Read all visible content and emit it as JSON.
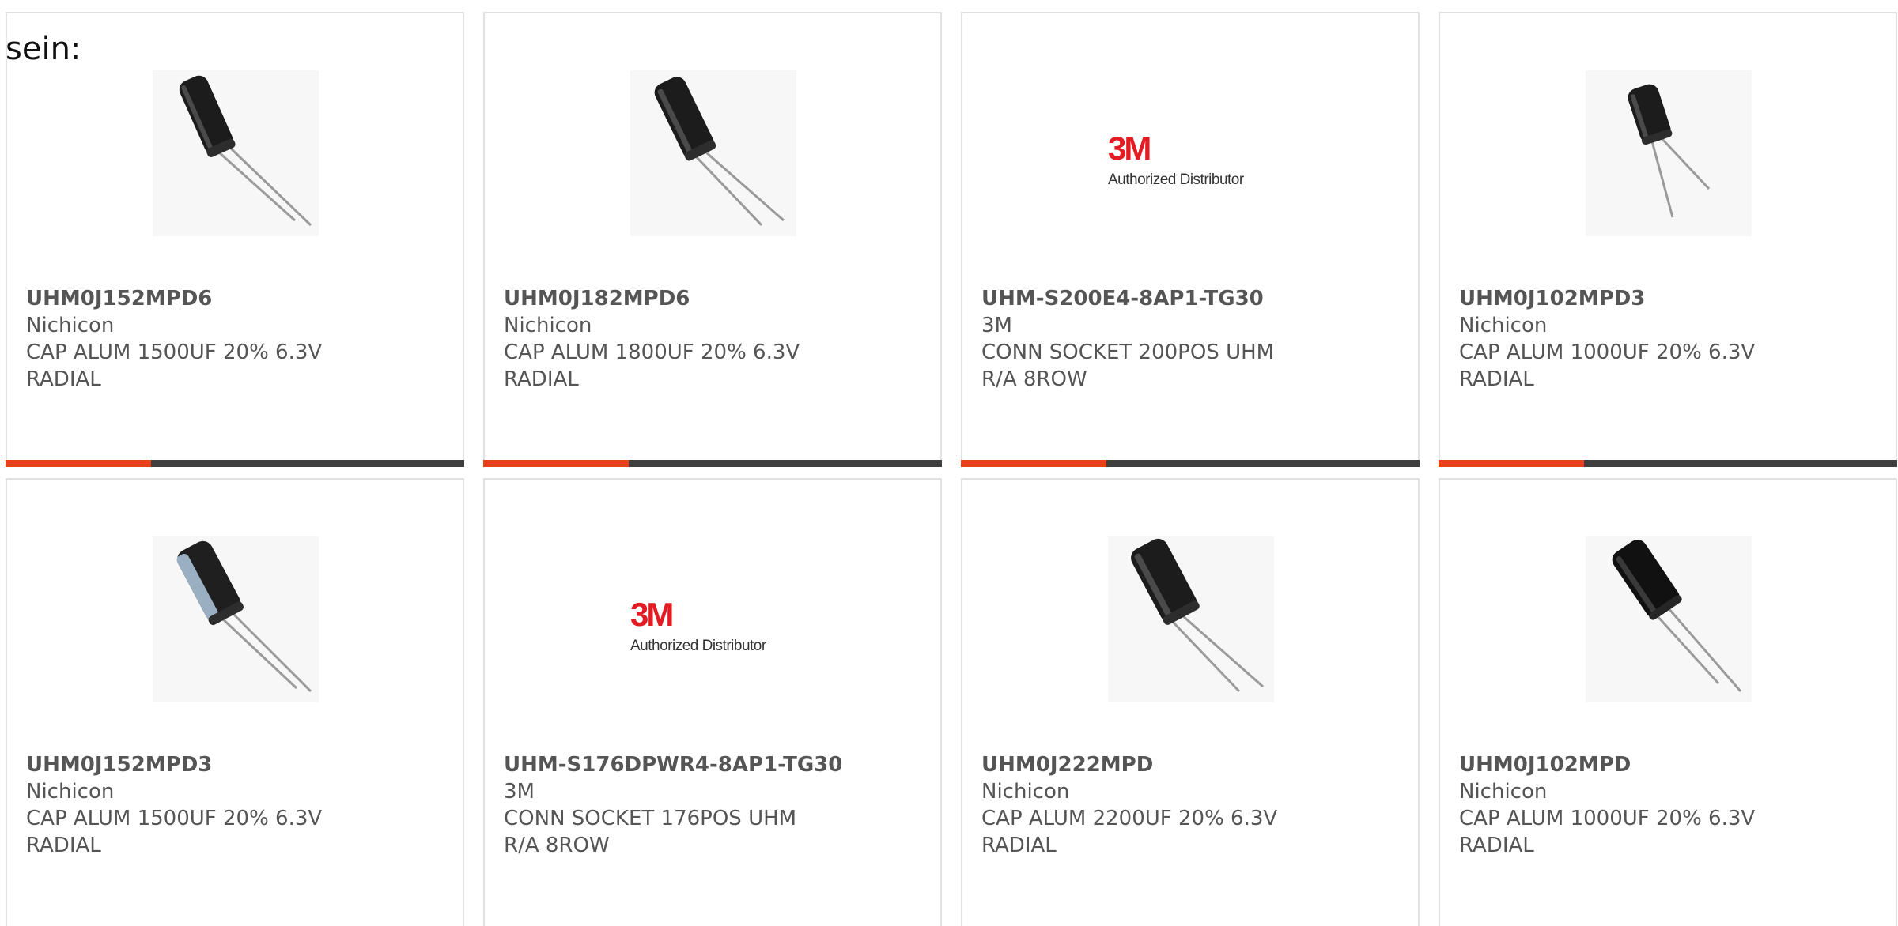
{
  "intro_text": "sein:",
  "products": [
    {
      "part_number": "UHM0J152MPD6",
      "manufacturer": "Nichicon",
      "description": "CAP ALUM 1500UF 20% 6.3V RADIAL",
      "image": "capacitor-angled"
    },
    {
      "part_number": "UHM0J182MPD6",
      "manufacturer": "Nichicon",
      "description": "CAP ALUM 1800UF 20% 6.3V RADIAL",
      "image": "capacitor-angled"
    },
    {
      "part_number": "UHM-S200E4-8AP1-TG30",
      "manufacturer": "3M",
      "description": "CONN SOCKET 200POS UHM R/A 8ROW",
      "image": "3m-logo"
    },
    {
      "part_number": "UHM0J102MPD3",
      "manufacturer": "Nichicon",
      "description": "CAP ALUM 1000UF 20% 6.3V RADIAL",
      "image": "capacitor-small"
    },
    {
      "part_number": "UHM0J152MPD3",
      "manufacturer": "Nichicon",
      "description": "CAP ALUM 1500UF 20% 6.3V RADIAL",
      "image": "capacitor-sleeved"
    },
    {
      "part_number": "UHM-S176DPWR4-8AP1-TG30",
      "manufacturer": "3M",
      "description": "CONN SOCKET 176POS UHM R/A 8ROW",
      "image": "3m-logo"
    },
    {
      "part_number": "UHM0J222MPD",
      "manufacturer": "Nichicon",
      "description": "CAP ALUM 2200UF 20% 6.3V RADIAL",
      "image": "capacitor-angled"
    },
    {
      "part_number": "UHM0J102MPD",
      "manufacturer": "Nichicon",
      "description": "CAP ALUM 1000UF 20% 6.3V RADIAL",
      "image": "capacitor-angled"
    }
  ],
  "logo_3m": {
    "mark": "3M",
    "tagline": "Authorized Distributor"
  },
  "colors": {
    "accent": "#e8411b",
    "bar": "#3f3f3f",
    "card_border": "#e1e1e1",
    "logo_red": "#e31b23"
  }
}
